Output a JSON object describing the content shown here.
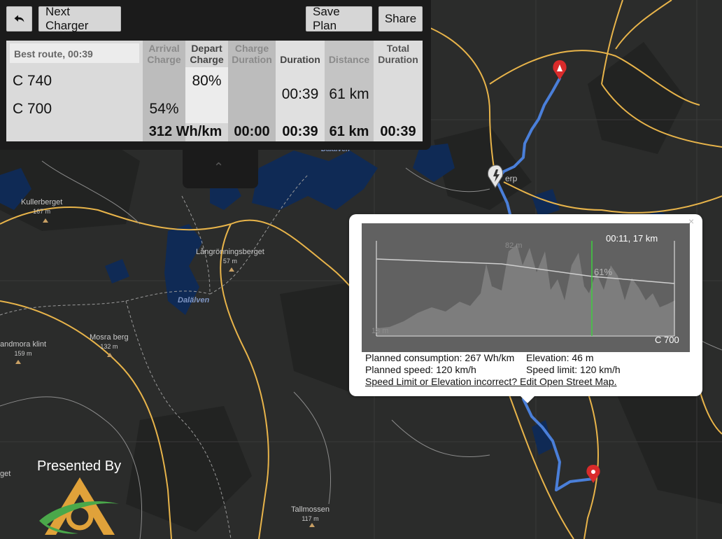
{
  "toolbar": {
    "back_icon": "back-arrow-icon",
    "next_charger_label": "Next Charger",
    "save_plan_label": "Save Plan",
    "share_label": "Share"
  },
  "route_table": {
    "route_title": "Best route, 00:39",
    "headers": {
      "arrival_charge": [
        "Arrival",
        "Charge"
      ],
      "depart_charge": [
        "Depart",
        "Charge"
      ],
      "charge_duration": [
        "Charge",
        "Duration"
      ],
      "duration": "Duration",
      "distance": "Distance",
      "total_duration": [
        "Total",
        "Duration"
      ]
    },
    "rows": [
      {
        "name": "C 740",
        "depart_charge": "80%"
      },
      {
        "name": "C 700",
        "arrival_charge": "54%"
      }
    ],
    "leg": {
      "duration": "00:39",
      "distance": "61 km"
    },
    "totals": {
      "consumption": "312 Wh/km",
      "charge_duration": "00:00",
      "duration": "00:39",
      "distance": "61 km",
      "total_duration": "00:39"
    },
    "collapse_icon": "chevron-up-icon"
  },
  "popup": {
    "close_label": "×",
    "chart": {
      "cursor_label": "00:11, 17 km",
      "max_elevation_label": "82 m",
      "min_elevation_label": "18 m",
      "cursor_charge_label": "61%",
      "destination_label": "C 700"
    },
    "details": {
      "planned_consumption": "Planned consumption: 267 Wh/km",
      "elevation": "Elevation: 46 m",
      "planned_speed": "Planned speed: 120 km/h",
      "speed_limit": "Speed limit: 120 km/h",
      "edit_link": "Speed Limit or Elevation incorrect? Edit Open Street Map."
    }
  },
  "map": {
    "labels": [
      {
        "name": "Kullerberget",
        "elev": "167 m"
      },
      {
        "name": "Långrönningsberget",
        "elev": "57 m"
      },
      {
        "name": "Mosra berg",
        "elev": "132 m"
      },
      {
        "name": "andmora klint",
        "elev": "159 m"
      },
      {
        "name": "Tallmossen",
        "elev": "117 m"
      },
      {
        "name": "erp",
        "elev": ""
      },
      {
        "name": "get",
        "elev": ""
      }
    ],
    "lakes": [
      "Dalälven",
      "Dalälven"
    ],
    "route_color": "#4a7fd9",
    "marker_color": "#d92b2b"
  },
  "branding": {
    "presented_by": "Presented By"
  }
}
